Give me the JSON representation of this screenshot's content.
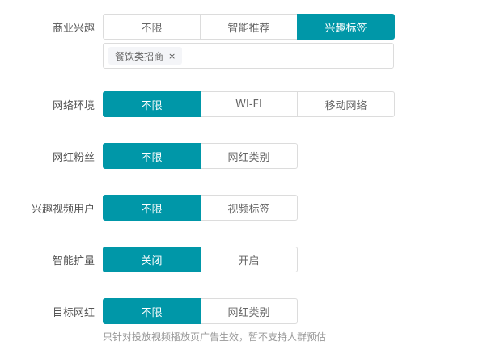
{
  "rows": [
    {
      "label": "商业兴趣",
      "options": [
        "不限",
        "智能推荐",
        "兴趣标签"
      ],
      "active": 2
    },
    {
      "label": "网络环境",
      "options": [
        "不限",
        "WI-FI",
        "移动网络"
      ],
      "active": 0
    },
    {
      "label": "网红粉丝",
      "options": [
        "不限",
        "网红类别"
      ],
      "active": 0
    },
    {
      "label": "兴趣视频用户",
      "options": [
        "不限",
        "视频标签"
      ],
      "active": 0
    },
    {
      "label": "智能扩量",
      "options": [
        "关闭",
        "开启"
      ],
      "active": 0
    },
    {
      "label": "目标网红",
      "options": [
        "不限",
        "网红类别"
      ],
      "active": 0
    }
  ],
  "interest_tags": [
    {
      "label": "餐饮类招商",
      "remove": "×"
    }
  ],
  "hint": "只针对投放视频播放页广告生效，暂不支持人群预估",
  "colors": {
    "accent": "#0097a8"
  }
}
